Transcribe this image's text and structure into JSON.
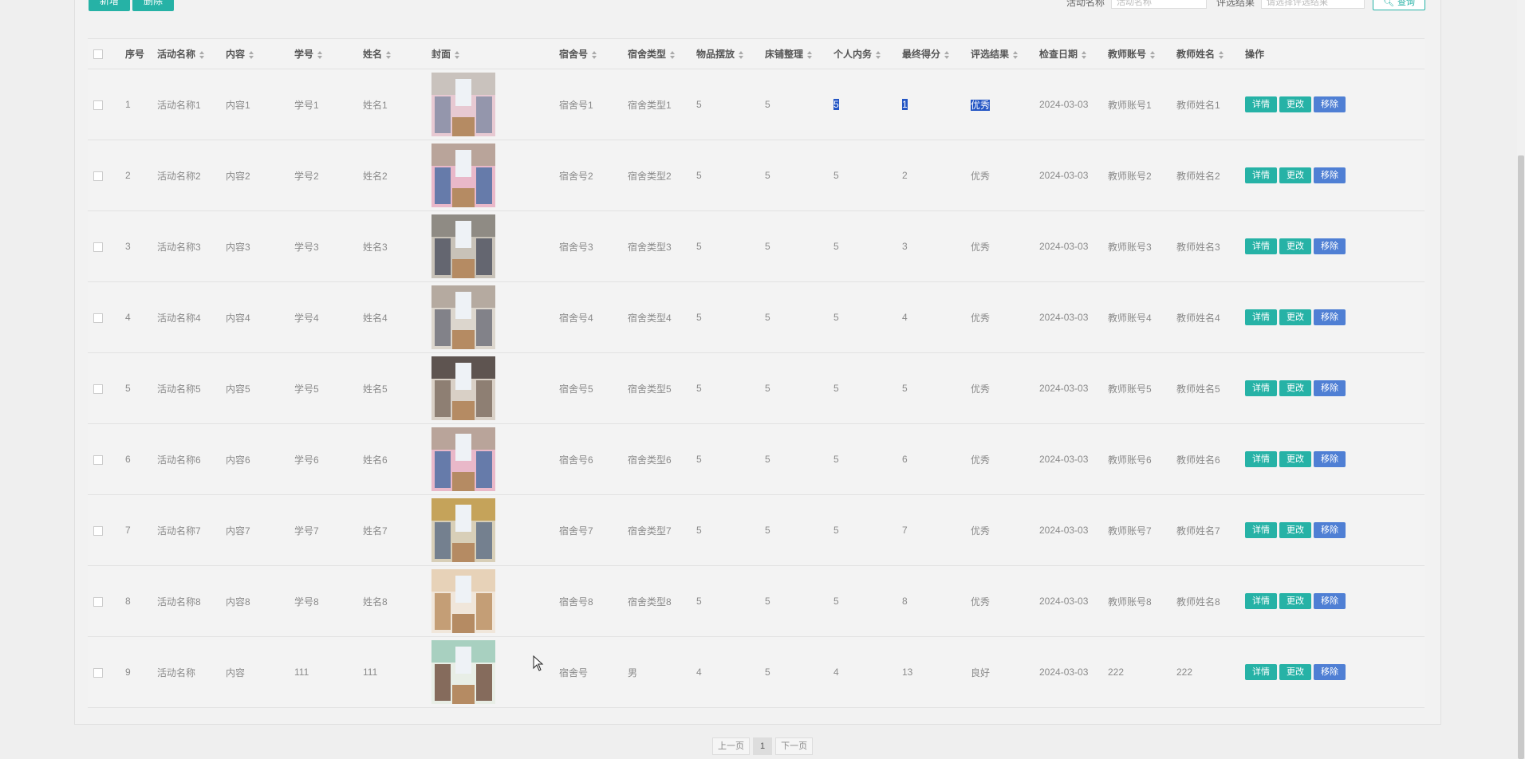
{
  "toolbar": {
    "add_label": "新增",
    "delete_label": "删除"
  },
  "search": {
    "name_label": "活动名称",
    "name_placeholder": "活动名称",
    "result_label": "评选结果",
    "result_placeholder": "请选择评选结果",
    "query_label": "查询"
  },
  "columns": [
    "序号",
    "活动名称",
    "内容",
    "学号",
    "姓名",
    "封面",
    "宿舍号",
    "宿舍类型",
    "物品摆放",
    "床铺整理",
    "个人内务",
    "最终得分",
    "评选结果",
    "检查日期",
    "教师账号",
    "教师姓名",
    "操作"
  ],
  "actions": {
    "detail": "详情",
    "edit": "更改",
    "remove": "移除"
  },
  "rows": [
    {
      "no": "1",
      "activity": "活动名称1",
      "content": "内容1",
      "student_id": "学号1",
      "name": "姓名1",
      "cover": "room-photo",
      "dorm": "宿舍号1",
      "dorm_type": "宿舍类型1",
      "items": "5",
      "bed": "5",
      "personal": "5",
      "score": "1",
      "result": "优秀",
      "date": "2024-03-03",
      "teacher_acct": "教师账号1",
      "teacher_name": "教师姓名1"
    },
    {
      "no": "2",
      "activity": "活动名称2",
      "content": "内容2",
      "student_id": "学号2",
      "name": "姓名2",
      "cover": "room-photo",
      "dorm": "宿舍号2",
      "dorm_type": "宿舍类型2",
      "items": "5",
      "bed": "5",
      "personal": "5",
      "score": "2",
      "result": "优秀",
      "date": "2024-03-03",
      "teacher_acct": "教师账号2",
      "teacher_name": "教师姓名2"
    },
    {
      "no": "3",
      "activity": "活动名称3",
      "content": "内容3",
      "student_id": "学号3",
      "name": "姓名3",
      "cover": "room-photo",
      "dorm": "宿舍号3",
      "dorm_type": "宿舍类型3",
      "items": "5",
      "bed": "5",
      "personal": "5",
      "score": "3",
      "result": "优秀",
      "date": "2024-03-03",
      "teacher_acct": "教师账号3",
      "teacher_name": "教师姓名3"
    },
    {
      "no": "4",
      "activity": "活动名称4",
      "content": "内容4",
      "student_id": "学号4",
      "name": "姓名4",
      "cover": "room-photo",
      "dorm": "宿舍号4",
      "dorm_type": "宿舍类型4",
      "items": "5",
      "bed": "5",
      "personal": "5",
      "score": "4",
      "result": "优秀",
      "date": "2024-03-03",
      "teacher_acct": "教师账号4",
      "teacher_name": "教师姓名4"
    },
    {
      "no": "5",
      "activity": "活动名称5",
      "content": "内容5",
      "student_id": "学号5",
      "name": "姓名5",
      "cover": "room-photo",
      "dorm": "宿舍号5",
      "dorm_type": "宿舍类型5",
      "items": "5",
      "bed": "5",
      "personal": "5",
      "score": "5",
      "result": "优秀",
      "date": "2024-03-03",
      "teacher_acct": "教师账号5",
      "teacher_name": "教师姓名5"
    },
    {
      "no": "6",
      "activity": "活动名称6",
      "content": "内容6",
      "student_id": "学号6",
      "name": "姓名6",
      "cover": "room-photo",
      "dorm": "宿舍号6",
      "dorm_type": "宿舍类型6",
      "items": "5",
      "bed": "5",
      "personal": "5",
      "score": "6",
      "result": "优秀",
      "date": "2024-03-03",
      "teacher_acct": "教师账号6",
      "teacher_name": "教师姓名6"
    },
    {
      "no": "7",
      "activity": "活动名称7",
      "content": "内容7",
      "student_id": "学号7",
      "name": "姓名7",
      "cover": "room-photo",
      "dorm": "宿舍号7",
      "dorm_type": "宿舍类型7",
      "items": "5",
      "bed": "5",
      "personal": "5",
      "score": "7",
      "result": "优秀",
      "date": "2024-03-03",
      "teacher_acct": "教师账号7",
      "teacher_name": "教师姓名7"
    },
    {
      "no": "8",
      "activity": "活动名称8",
      "content": "内容8",
      "student_id": "学号8",
      "name": "姓名8",
      "cover": "room-photo",
      "dorm": "宿舍号8",
      "dorm_type": "宿舍类型8",
      "items": "5",
      "bed": "5",
      "personal": "5",
      "score": "8",
      "result": "优秀",
      "date": "2024-03-03",
      "teacher_acct": "教师账号8",
      "teacher_name": "教师姓名8"
    },
    {
      "no": "9",
      "activity": "活动名称",
      "content": "内容",
      "student_id": "111",
      "name": "111",
      "cover": "room-photo",
      "dorm": "宿舍号",
      "dorm_type": "男",
      "items": "4",
      "bed": "5",
      "personal": "4",
      "score": "13",
      "result": "良好",
      "date": "2024-03-03",
      "teacher_acct": "222",
      "teacher_name": "222"
    }
  ],
  "pager": {
    "prev": "上一页",
    "current": "1",
    "next": "下一页"
  },
  "colors": {
    "accent": "#26b2a6",
    "remove": "#4f7fd4",
    "selection": "#2456c4"
  }
}
